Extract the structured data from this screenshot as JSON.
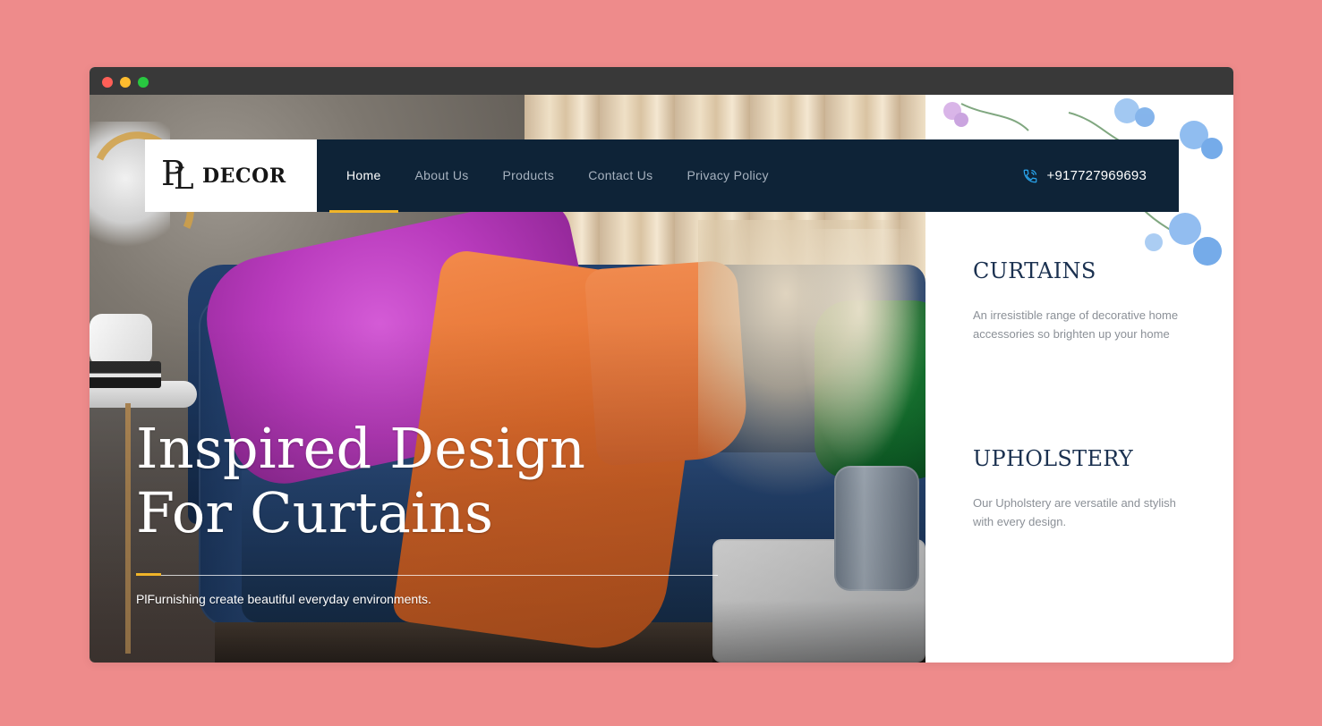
{
  "brand": {
    "logo_text": "DECOR",
    "mark_p": "P",
    "mark_l": "L"
  },
  "nav": {
    "items": [
      {
        "label": "Home",
        "active": true
      },
      {
        "label": "About Us",
        "active": false
      },
      {
        "label": "Products",
        "active": false
      },
      {
        "label": "Contact Us",
        "active": false
      },
      {
        "label": "Privacy Policy",
        "active": false
      }
    ],
    "phone": "+917727969693",
    "phone_icon": "phone-icon"
  },
  "hero": {
    "title_line1": "Inspired Design",
    "title_line2": "For Curtains",
    "subtitle": "PlFurnishing create beautiful everyday environments."
  },
  "services": [
    {
      "title": "CURTAINS",
      "description": "An irresistible range of decorative home accessories so brighten up your home"
    },
    {
      "title": "UPHOLSTERY",
      "description": "Our Upholstery are versatile and stylish with every design."
    }
  ],
  "colors": {
    "background": "#ee8b8b",
    "nav_bg": "#0e2337",
    "accent": "#f0b429",
    "heading": "#1b3150"
  }
}
